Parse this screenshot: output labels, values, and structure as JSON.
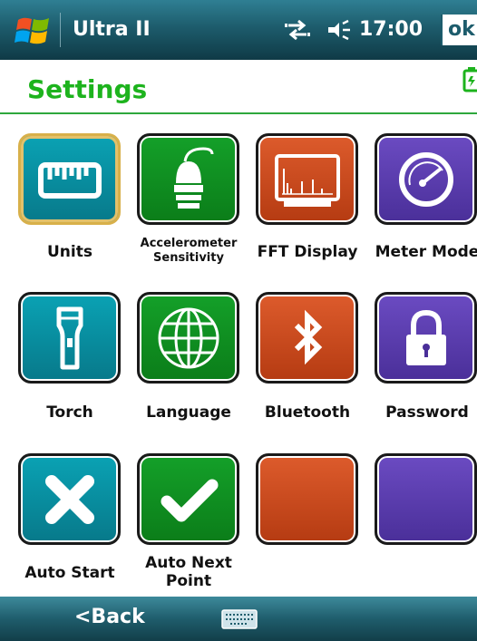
{
  "titlebar": {
    "app_title": "Ultra II",
    "time": "17:00",
    "ok_label": "ok",
    "icons": [
      "windows-start-icon",
      "sync-icon",
      "speaker-icon"
    ]
  },
  "header": {
    "title": "Settings",
    "icons": [
      "battery-icon"
    ]
  },
  "tiles": [
    {
      "label": "Units",
      "icon": "ruler-icon",
      "color": "#07798a",
      "selected": true
    },
    {
      "label": "Accelerometer Sensitivity",
      "icon": "accelerometer-icon",
      "color": "#0b7d19"
    },
    {
      "label": "FFT Display",
      "icon": "fft-display-icon",
      "color": "#b53b12"
    },
    {
      "label": "Meter Mode",
      "icon": "meter-gauge-icon",
      "color": "#4a2f99"
    },
    {
      "label": "Torch",
      "icon": "torch-icon",
      "color": "#07798a"
    },
    {
      "label": "Language",
      "icon": "globe-icon",
      "color": "#0b7d19"
    },
    {
      "label": "Bluetooth",
      "icon": "bluetooth-icon",
      "color": "#b53b12"
    },
    {
      "label": "Password",
      "icon": "padlock-icon",
      "color": "#4a2f99"
    },
    {
      "label": "Auto Start",
      "icon": "x-mark-icon",
      "color": "#07798a"
    },
    {
      "label": "Auto Next Point",
      "icon": "checkmark-icon",
      "color": "#0b7d19"
    },
    {
      "label": "",
      "icon": "",
      "color": "#b53b12"
    },
    {
      "label": "",
      "icon": "",
      "color": "#4a2f99"
    }
  ],
  "bottombar": {
    "back_label": "<Back",
    "icons": [
      "keyboard-icon"
    ]
  },
  "colors": {
    "accent_green": "#1db31d",
    "titlebar": "#1d5c6c"
  }
}
